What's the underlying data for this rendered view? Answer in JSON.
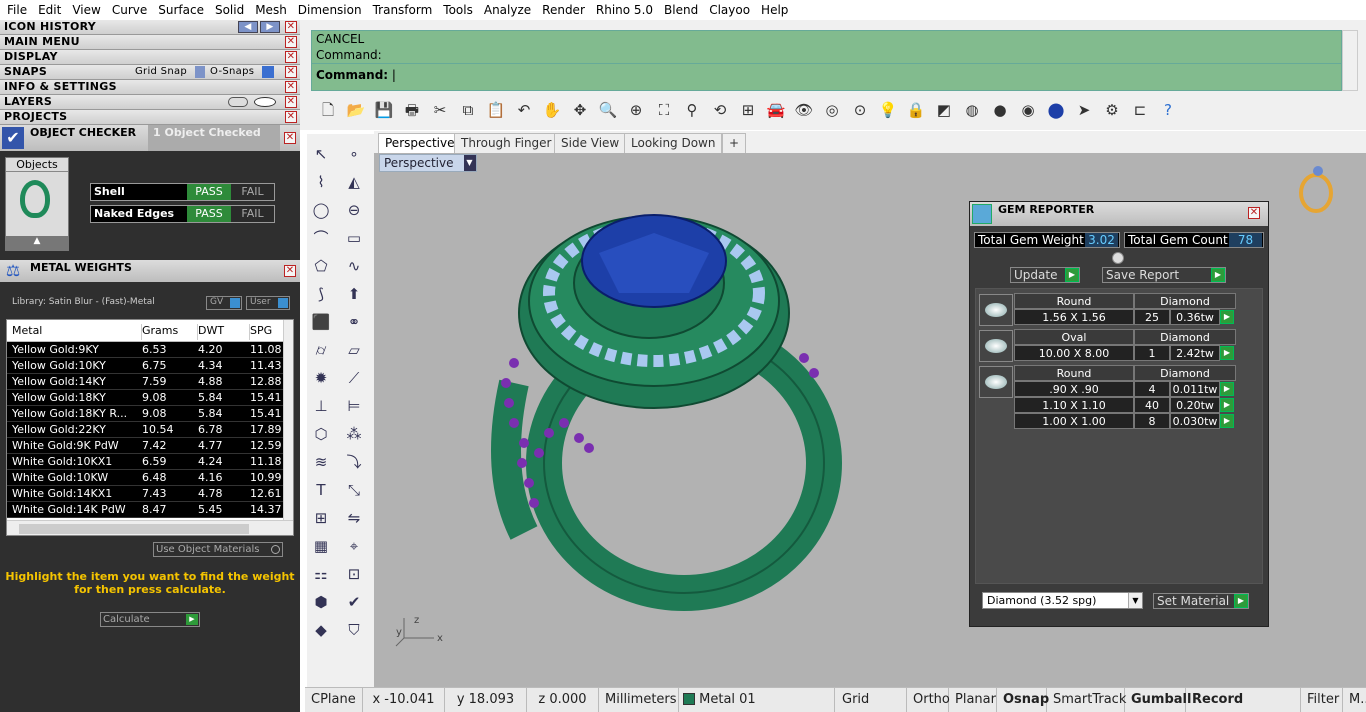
{
  "menubar": [
    "File",
    "Edit",
    "View",
    "Curve",
    "Surface",
    "Solid",
    "Mesh",
    "Dimension",
    "Transform",
    "Tools",
    "Analyze",
    "Render",
    "Rhino 5.0",
    "Blend",
    "Clayoo",
    "Help"
  ],
  "left": {
    "icon_history": "ICON HISTORY",
    "main_menu": "MAIN MENU",
    "display": "DISPLAY",
    "snaps": "SNAPS",
    "grid_snap": "Grid Snap",
    "o_snaps": "O-Snaps",
    "info_settings": "INFO & SETTINGS",
    "layers": "LAYERS",
    "projects": "PROJECTS",
    "object_checker": "OBJECT CHECKER",
    "object_checked": "1  Object Checked",
    "objects_label": "Objects",
    "shell": "Shell",
    "naked_edges": "Naked Edges",
    "pass": "PASS",
    "fail": "FAIL",
    "metal_weights": "METAL WEIGHTS",
    "library": "Library: Satin Blur - (Fast)-Metal",
    "gv": "GV",
    "user": "User",
    "columns": [
      "Metal",
      "Grams",
      "DWT",
      "SPG"
    ],
    "rows": [
      [
        "Yellow Gold:9KY",
        "6.53",
        "4.20",
        "11.08"
      ],
      [
        "Yellow Gold:10KY",
        "6.75",
        "4.34",
        "11.43"
      ],
      [
        "Yellow Gold:14KY",
        "7.59",
        "4.88",
        "12.88"
      ],
      [
        "Yellow Gold:18KY",
        "9.08",
        "5.84",
        "15.41"
      ],
      [
        "Yellow Gold:18KY R...",
        "9.08",
        "5.84",
        "15.41"
      ],
      [
        "Yellow Gold:22KY",
        "10.54",
        "6.78",
        "17.89"
      ],
      [
        "White Gold:9K PdW",
        "7.42",
        "4.77",
        "12.59"
      ],
      [
        "White Gold:10KX1",
        "6.59",
        "4.24",
        "11.18"
      ],
      [
        "White Gold:10KW",
        "6.48",
        "4.16",
        "10.99"
      ],
      [
        "White Gold:14KX1",
        "7.43",
        "4.78",
        "12.61"
      ],
      [
        "White Gold:14K PdW",
        "8.47",
        "5.45",
        "14.37"
      ]
    ],
    "use_object_materials": "Use Object Materials",
    "hint1": "Highlight the item you want to find the weight",
    "hint2": "for then press calculate.",
    "calculate": "Calculate"
  },
  "command": {
    "line1": "CANCEL",
    "line2": "Command:",
    "line3": "Command:"
  },
  "viewport_tabs": [
    "Perspective",
    "Through Finger",
    "Side View",
    "Looking Down",
    "+"
  ],
  "viewport_label": "Perspective",
  "axis": {
    "x": "x",
    "y": "y",
    "z": "z"
  },
  "gem": {
    "title": "GEM REPORTER",
    "total_weight_label": "Total Gem Weight",
    "total_weight": "3.02",
    "total_count_label": "Total Gem Count",
    "total_count": "78",
    "update": "Update",
    "save_report": "Save Report",
    "groups": [
      {
        "shape": "Round",
        "type": "Diamond",
        "rows": [
          [
            "1.56 X 1.56",
            "25",
            "0.36tw"
          ]
        ]
      },
      {
        "shape": "Oval",
        "type": "Diamond",
        "rows": [
          [
            "10.00 X 8.00",
            "1",
            "2.42tw"
          ]
        ]
      },
      {
        "shape": "Round",
        "type": "Diamond",
        "rows": [
          [
            ".90 X .90",
            "4",
            "0.011tw"
          ],
          [
            "1.10 X 1.10",
            "40",
            "0.20tw"
          ],
          [
            "1.00 X 1.00",
            "8",
            "0.030tw"
          ]
        ]
      }
    ],
    "material": "Diamond     (3.52 spg)",
    "set_material": "Set Material"
  },
  "status": {
    "cplane": "CPlane",
    "x": "x -10.041",
    "y": "y 18.093",
    "z": "z 0.000",
    "units": "Millimeters",
    "layer": "Metal 01",
    "grid_snap": "Grid Snap",
    "ortho": "Ortho",
    "planar": "Planar",
    "osnap": "Osnap",
    "smarttrack": "SmartTrack",
    "gumball": "Gumball",
    "record_history": "Record History",
    "filter": "Filter",
    "more": "M.."
  },
  "colors": {
    "ring": "#1f7a55",
    "gem": "#1d3fa8",
    "accent_green": "#2e9b3a",
    "cmd_bg": "#82bb8e"
  }
}
